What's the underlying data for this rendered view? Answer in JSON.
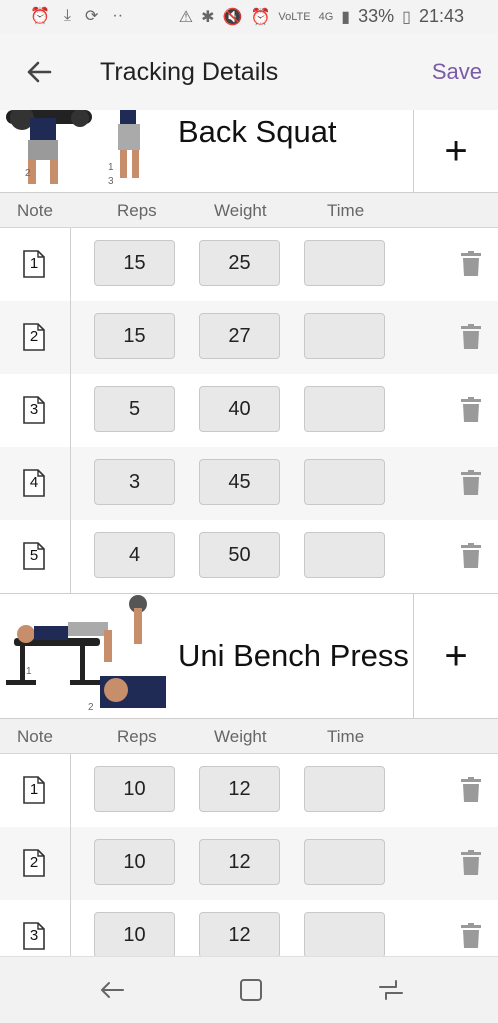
{
  "status_bar": {
    "left_icons": [
      "alarm-icon",
      "download-icon",
      "sync-icon",
      "more-icon"
    ],
    "right_icons": [
      "data-saver-icon",
      "bluetooth-icon",
      "mute-icon",
      "alarm-icon",
      "volte-icon",
      "4g-icon",
      "signal-icon"
    ],
    "battery": "33%",
    "time": "21:43"
  },
  "app_bar": {
    "title": "Tracking Details",
    "save_label": "Save"
  },
  "columns": {
    "note": "Note",
    "reps": "Reps",
    "weight": "Weight",
    "time": "Time"
  },
  "exercises": [
    {
      "name": "Back Squat",
      "add_label": "+",
      "image_labels": [
        "2",
        "1",
        "3"
      ],
      "sets": [
        {
          "note": "1",
          "reps": "15",
          "weight": "25",
          "time": ""
        },
        {
          "note": "2",
          "reps": "15",
          "weight": "27",
          "time": ""
        },
        {
          "note": "3",
          "reps": "5",
          "weight": "40",
          "time": ""
        },
        {
          "note": "4",
          "reps": "3",
          "weight": "45",
          "time": ""
        },
        {
          "note": "5",
          "reps": "4",
          "weight": "50",
          "time": ""
        }
      ]
    },
    {
      "name": "Uni Bench Press",
      "add_label": "+",
      "image_labels": [
        "1",
        "2"
      ],
      "sets": [
        {
          "note": "1",
          "reps": "10",
          "weight": "12",
          "time": ""
        },
        {
          "note": "2",
          "reps": "10",
          "weight": "12",
          "time": ""
        },
        {
          "note": "3",
          "reps": "10",
          "weight": "12",
          "time": ""
        }
      ]
    }
  ],
  "colors": {
    "accent": "#7b5aa6",
    "field_bg": "#e8e8e8",
    "header_bg": "#f1f1f1"
  }
}
